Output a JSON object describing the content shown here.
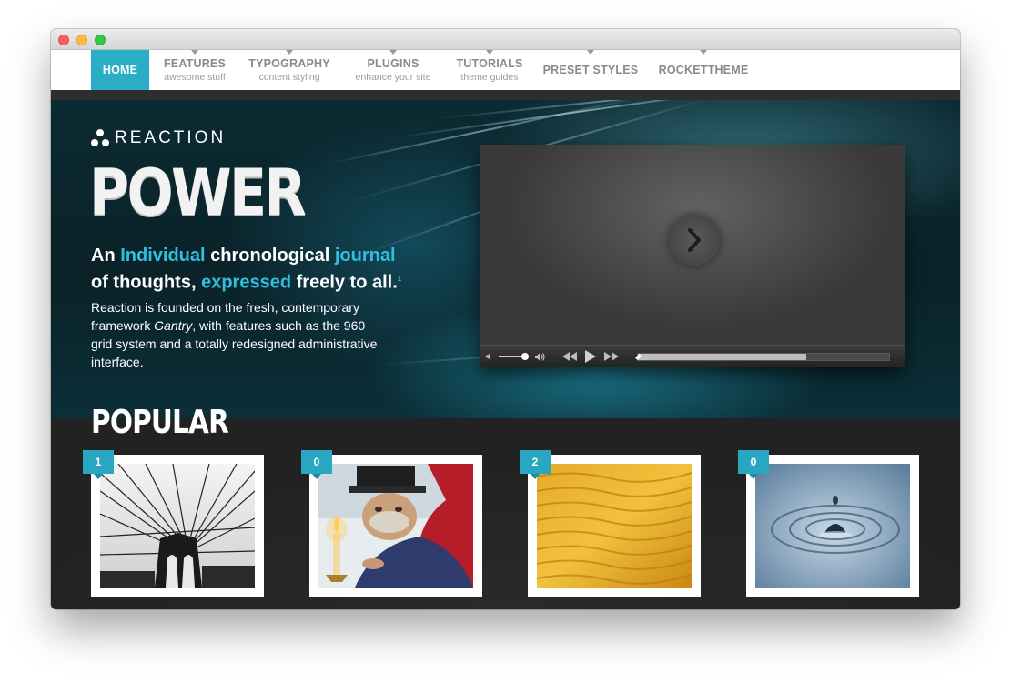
{
  "colors": {
    "accent": "#2aaec6",
    "highlight": "#2ec0de",
    "dark": "#262626"
  },
  "nav": {
    "items": [
      {
        "label": "HOME",
        "sub": ""
      },
      {
        "label": "FEATURES",
        "sub": "awesome stuff"
      },
      {
        "label": "TYPOGRAPHY",
        "sub": "content styling"
      },
      {
        "label": "PLUGINS",
        "sub": "enhance your site"
      },
      {
        "label": "TUTORIALS",
        "sub": "theme guides"
      },
      {
        "label": "PRESET STYLES",
        "sub": ""
      },
      {
        "label": "ROCKETTHEME",
        "sub": ""
      }
    ]
  },
  "hero": {
    "logo_text": "REACTION",
    "headline": "POWER",
    "tagline": {
      "an": "An",
      "individual": "Individual",
      "chronological": "chronological",
      "journal": "journal",
      "of_thoughts": "of thoughts,",
      "expressed": "expressed",
      "freely": "freely to all.",
      "footnote": "1"
    },
    "desc": {
      "part1": "Reaction is founded on the fresh, contemporary framework ",
      "gantry": "Gantry",
      "part2": ", with features such as the 960 grid system and a totally redesigned administrative interface."
    }
  },
  "video": {
    "progress": 0.0,
    "buffered": 0.67,
    "volume": 0.9,
    "icons": {
      "volume_low": "speaker-low-icon",
      "volume_high": "speaker-high-icon",
      "rewind": "rewind-icon",
      "play": "play-icon",
      "forward": "fast-forward-icon"
    }
  },
  "popular": {
    "title": "POPULAR",
    "cards": [
      {
        "count": "1",
        "image": "bridge-cables-photo"
      },
      {
        "count": "0",
        "image": "scrooge-candle-illustration"
      },
      {
        "count": "2",
        "image": "sand-dunes-photo"
      },
      {
        "count": "0",
        "image": "water-drop-photo"
      }
    ]
  }
}
